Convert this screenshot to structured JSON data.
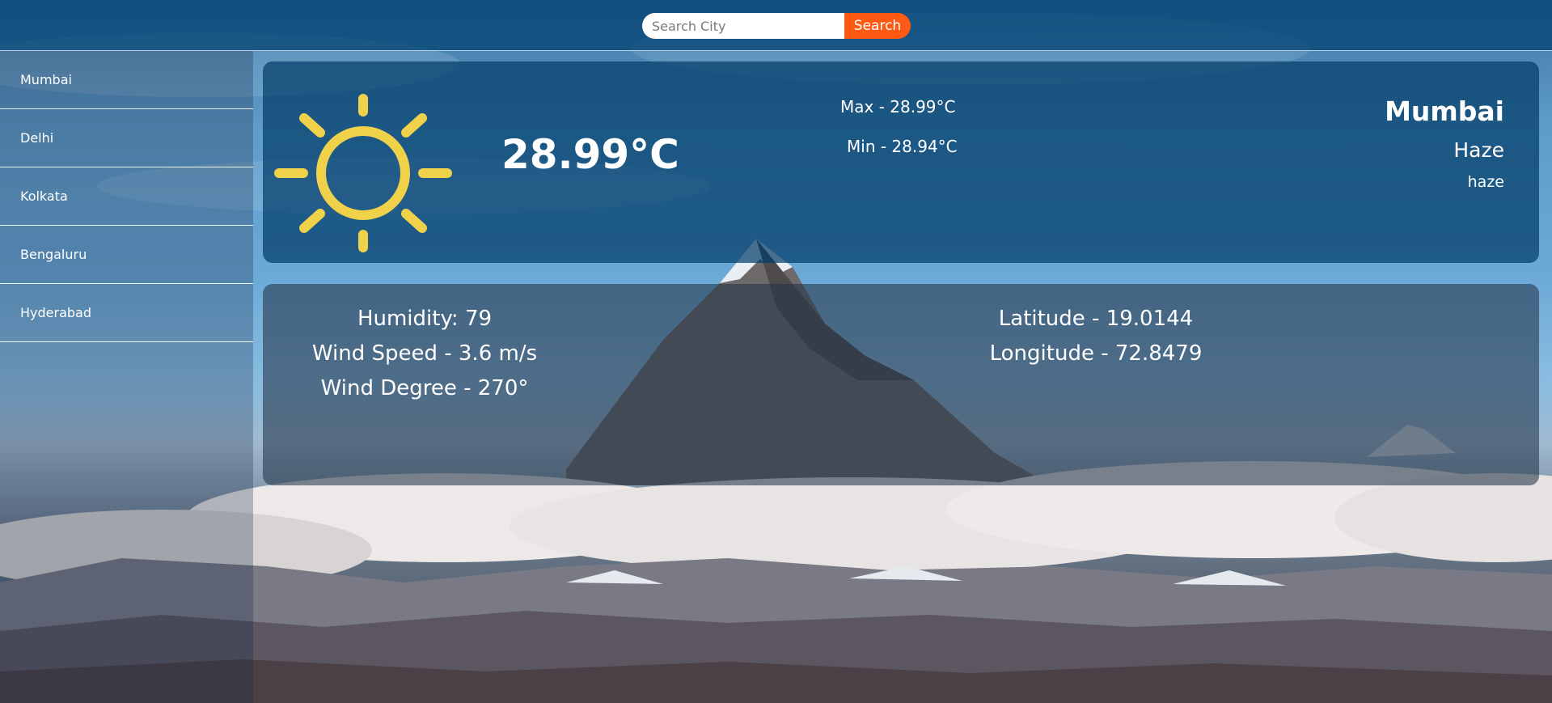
{
  "search": {
    "placeholder": "Search City",
    "button_label": "Search",
    "accent_color": "#ff5a14"
  },
  "sidebar": {
    "items": [
      {
        "label": "Mumbai"
      },
      {
        "label": "Delhi"
      },
      {
        "label": "Kolkata"
      },
      {
        "label": "Bengaluru"
      },
      {
        "label": "Hyderabad"
      }
    ]
  },
  "weather": {
    "icon": "sun-icon",
    "icon_color": "#f0d24a",
    "temperature": "28.99°C",
    "max": "Max - 28.99°C",
    "min": "Min - 28.94°C",
    "city": "Mumbai",
    "condition": "Haze",
    "description": "haze"
  },
  "details": {
    "humidity": "Humidity: 79",
    "wind_speed": "Wind Speed - 3.6 m/s",
    "wind_degree": "Wind Degree - 270°",
    "latitude": "Latitude - 19.0144",
    "longitude": "Longitude - 72.8479"
  }
}
